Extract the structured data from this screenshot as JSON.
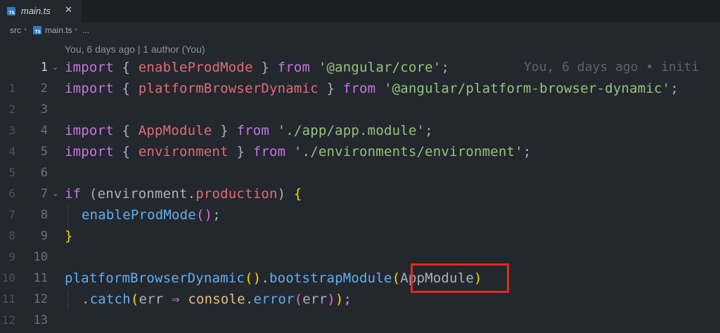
{
  "tab": {
    "label": "main.ts",
    "close": "✕",
    "icon": "TS"
  },
  "breadcrumb": {
    "folder": "src",
    "file": "main.ts",
    "more": "...",
    "sep": "›"
  },
  "codelens": "You, 6 days ago | 1 author (You)",
  "blame": "You, 6 days ago • initi",
  "lines": [
    {
      "rel": "",
      "abs": "1",
      "tokens": [
        "import",
        " { ",
        "enableProdMode",
        " } ",
        "from",
        " ",
        "'@angular/core'",
        ";"
      ]
    },
    {
      "rel": "1",
      "abs": "2",
      "tokens": [
        "import",
        " { ",
        "platformBrowserDynamic",
        " } ",
        "from",
        " ",
        "'@angular/platform-browser-dynamic'",
        ";"
      ]
    },
    {
      "rel": "2",
      "abs": "3"
    },
    {
      "rel": "3",
      "abs": "4",
      "tokens": [
        "import",
        " { ",
        "AppModule",
        " } ",
        "from",
        " ",
        "'./app/app.module'",
        ";"
      ]
    },
    {
      "rel": "4",
      "abs": "5",
      "tokens": [
        "import",
        " { ",
        "environment",
        " } ",
        "from",
        " ",
        "'./environments/environment'",
        ";"
      ]
    },
    {
      "rel": "5",
      "abs": "6"
    },
    {
      "rel": "6",
      "abs": "7",
      "tokens": [
        "if",
        " (",
        "environment",
        ".",
        "production",
        ") ",
        "{"
      ]
    },
    {
      "rel": "7",
      "abs": "8",
      "tokens": [
        "enableProdMode",
        "()",
        ";"
      ]
    },
    {
      "rel": "8",
      "abs": "9",
      "tokens": [
        "}"
      ]
    },
    {
      "rel": "9",
      "abs": "10"
    },
    {
      "rel": "10",
      "abs": "11",
      "tokens": [
        "platformBrowserDynamic",
        "()",
        ".",
        "bootstrapModule",
        "(",
        "AppModule",
        ")"
      ]
    },
    {
      "rel": "11",
      "abs": "12",
      "tokens": [
        ".",
        "catch",
        "(",
        "err",
        " ⇒ ",
        "console",
        ".",
        "error",
        "(",
        "err",
        ")",
        ")",
        ";"
      ]
    },
    {
      "rel": "12",
      "abs": "13"
    }
  ],
  "colors": {
    "keyword": "#c678dd",
    "identifier": "#e06c75",
    "string": "#98c379",
    "function": "#61afef",
    "highlight": "#e02b20",
    "background": "#23272e"
  }
}
